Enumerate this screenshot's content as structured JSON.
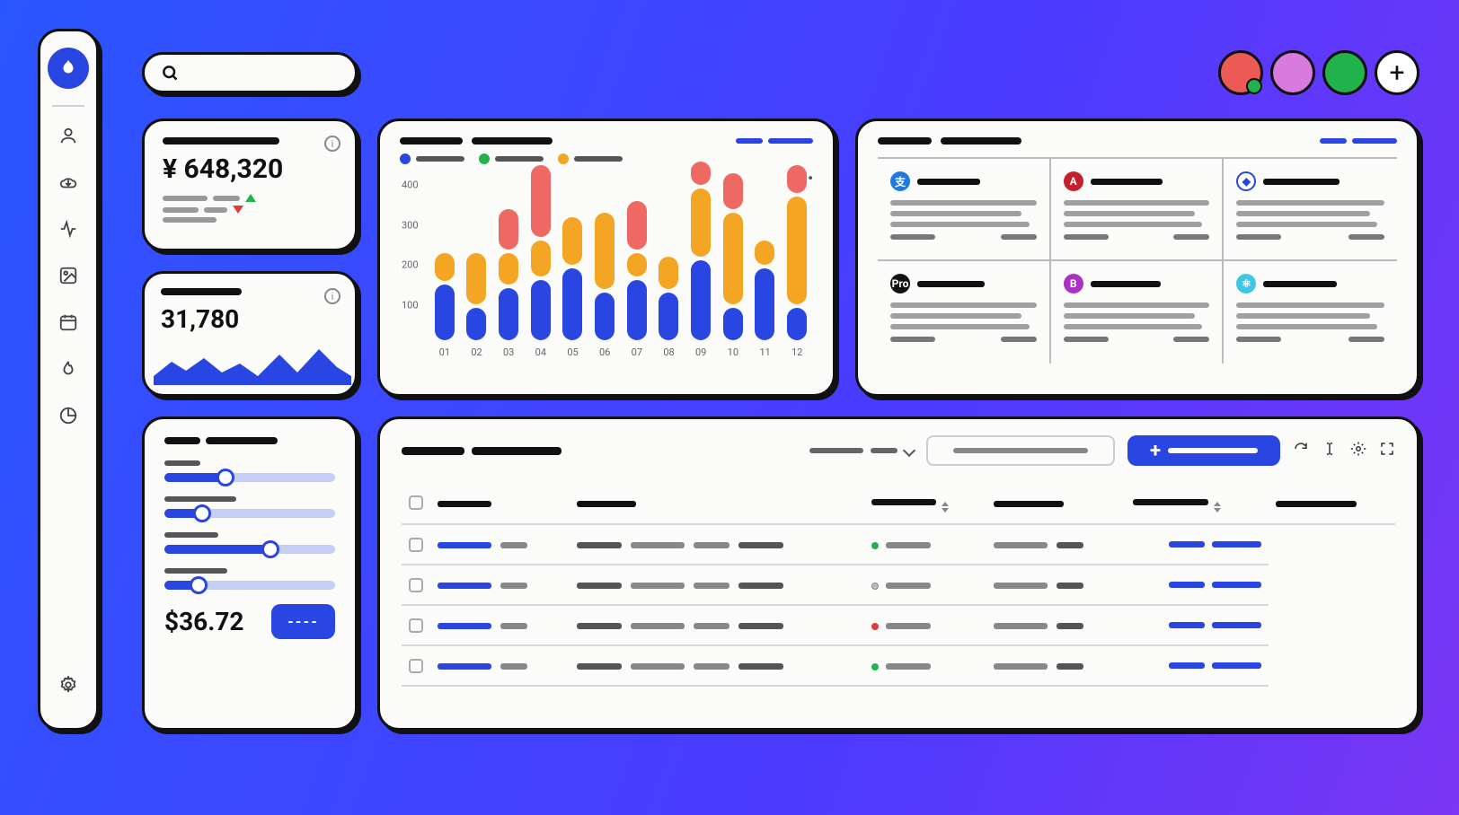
{
  "nav": {
    "items": [
      "user",
      "download",
      "activity",
      "image",
      "calendar",
      "flame",
      "pie-chart"
    ],
    "settings": "settings"
  },
  "search": {
    "placeholder": ""
  },
  "avatars": {
    "colors": [
      "red",
      "pink",
      "green"
    ],
    "add_label": "+"
  },
  "revenue": {
    "label": "━━━━━━━",
    "value": "¥ 648,320",
    "delta_up": "━━━━━",
    "delta_down": "━━━━━",
    "subtext": "━━━━"
  },
  "visitors": {
    "label": "━━━━━",
    "value": "31,780"
  },
  "sliders": {
    "title": [
      "━━━",
      "━━━━━━"
    ],
    "items": [
      {
        "label_w": 40,
        "value": 36
      },
      {
        "label_w": 80,
        "value": 22
      },
      {
        "label_w": 60,
        "value": 62
      },
      {
        "label_w": 70,
        "value": 20
      }
    ],
    "price": "$36.72",
    "button_label": "----"
  },
  "chart_data": {
    "type": "stacked-bar",
    "title": "━━━━━  ━━━━━━━",
    "links": [
      "━━━",
      "━━━━"
    ],
    "legend": [
      {
        "color": "#2a46e2",
        "label": "━━━━━"
      },
      {
        "color": "#22b24b",
        "label": "━━━━━"
      },
      {
        "color": "#f4a524",
        "label": "━━━"
      }
    ],
    "categories": [
      "01",
      "02",
      "03",
      "04",
      "05",
      "06",
      "07",
      "08",
      "09",
      "10",
      "11",
      "12"
    ],
    "ylim": [
      0,
      400
    ],
    "yticks": [
      100,
      200,
      300,
      400
    ],
    "series": [
      {
        "name": "blue",
        "values": [
          140,
          80,
          130,
          150,
          180,
          120,
          150,
          120,
          200,
          80,
          180,
          80
        ]
      },
      {
        "name": "orange",
        "values": [
          70,
          130,
          80,
          90,
          120,
          190,
          60,
          80,
          170,
          230,
          60,
          270
        ]
      },
      {
        "name": "red",
        "values": [
          0,
          0,
          100,
          180,
          0,
          0,
          120,
          0,
          60,
          90,
          0,
          70
        ]
      }
    ]
  },
  "partners": {
    "title": [
      "━━━━",
      "━━━━━━"
    ],
    "links": [
      "━━━",
      "━━━━"
    ],
    "cells": [
      {
        "icon": "支",
        "color": "#1f7ae0",
        "name_w": 70
      },
      {
        "icon": "A",
        "color": "#c51f2e",
        "name_w": 80
      },
      {
        "icon": "◆",
        "color": "#fff",
        "ring": "#2a46e2",
        "name_w": 85
      },
      {
        "icon": "Pro",
        "color": "#111",
        "name_w": 75
      },
      {
        "icon": "B",
        "color": "#a932c4",
        "name_w": 78
      },
      {
        "icon": "⚛",
        "color": "#3cc7e6",
        "name_w": 82
      }
    ]
  },
  "table": {
    "title": [
      "━━━━━",
      "━━━━━━━"
    ],
    "dropdown": "━━━━━  ━━━",
    "search_field": "━━━━━━━━",
    "primary_btn": "━━━━━━",
    "columns": [
      {
        "label": "━━━━━",
        "sortable": false
      },
      {
        "label": "━━━━━━━",
        "sortable": false
      },
      {
        "label": "━━━━━━",
        "sortable": true
      },
      {
        "label": "━━━━━",
        "sortable": false
      },
      {
        "label": "━━━━━━",
        "sortable": true
      },
      {
        "label": "━━━",
        "sortable": false
      }
    ],
    "rows": [
      {
        "status": "sg"
      },
      {
        "status": "so"
      },
      {
        "status": "sr"
      },
      {
        "status": "sg"
      }
    ]
  }
}
